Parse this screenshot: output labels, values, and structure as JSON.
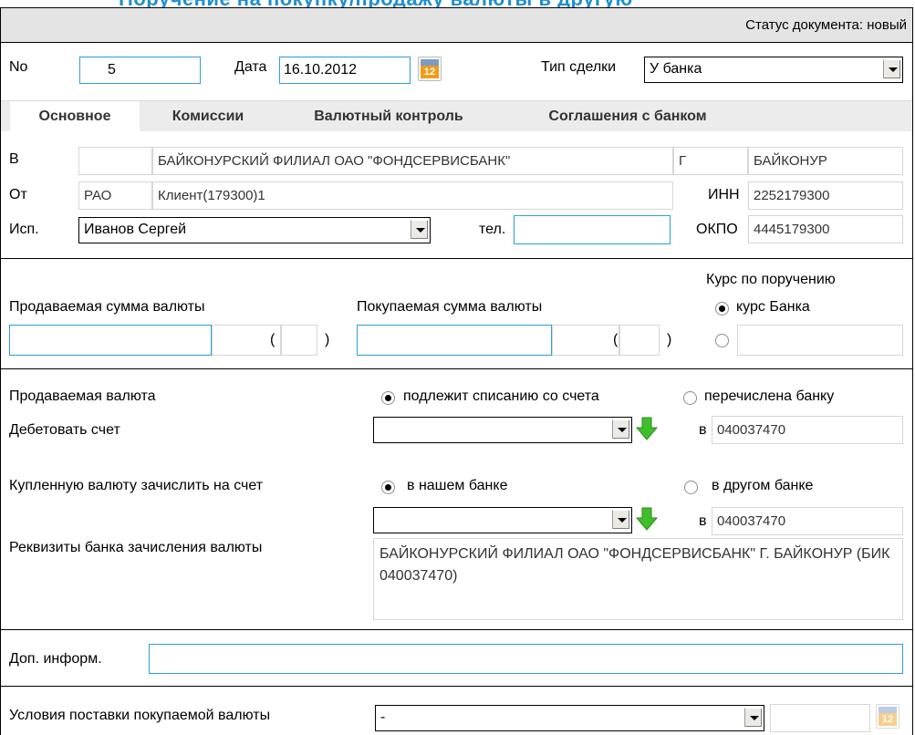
{
  "page_title": "Поручение на покупку/продажу валюты в другую",
  "status": "Статус документа: новый",
  "header": {
    "no_label": "No",
    "no_value": "5",
    "date_label": "Дата",
    "date_value": "16.10.2012",
    "calendar_day": "12",
    "deal_type_label": "Тип сделки",
    "deal_type_value": "У банка"
  },
  "tabs": [
    {
      "label": "Основное",
      "active": true
    },
    {
      "label": "Комиссии",
      "active": false
    },
    {
      "label": "Валютный контроль",
      "active": false
    },
    {
      "label": "Соглашения с банком",
      "active": false
    }
  ],
  "parties": {
    "to_label": "В",
    "to_code": "",
    "to_bank": "БАЙКОНУРСКИЙ ФИЛИАЛ ОАО \"ФОНДСЕРВИСБАНК\"",
    "to_city_prefix": "Г",
    "to_city": "БАЙКОНУР",
    "from_label": "От",
    "from_code": "РАО",
    "from_client": "Клиент(179300)1",
    "inn_label": "ИНН",
    "inn_value": "2252179300",
    "exec_label": "Исп.",
    "exec_value": "Иванов Сергей",
    "phone_label": "тел.",
    "phone_value": "",
    "okpo_label": "ОКПО",
    "okpo_value": "4445179300"
  },
  "amounts": {
    "rate_title": "Курс по поручению",
    "sold_label": "Продаваемая сумма валюты",
    "bought_label": "Покупаемая сумма валюты",
    "rate_bank_label": "курс Банка",
    "paren_open": "(",
    "paren_close": ")"
  },
  "sold_currency": {
    "label": "Продаваемая валюта",
    "opt_debit": "подлежит списанию со счета",
    "opt_transfer": "перечислена банку",
    "debit_label": "Дебетовать счет",
    "in_label": "в",
    "bik": "040037470"
  },
  "bought_currency": {
    "label": "Купленную валюту зачислить на счет",
    "opt_our_bank": "в нашем банке",
    "opt_other_bank": "в другом банке",
    "in_label": "в",
    "bik": "040037470",
    "bank_details_label": "Реквизиты банка зачисления валюты",
    "bank_details": "БАЙКОНУРСКИЙ ФИЛИАЛ ОАО \"ФОНДСЕРВИСБАНК\" Г. БАЙКОНУР (БИК 040037470)"
  },
  "extra": {
    "info_label": "Доп. информ.",
    "info_value": "",
    "delivery_label": "Условия поставки покупаемой валюты",
    "delivery_value": "-",
    "calendar_day": "12"
  },
  "colors": {
    "accent": "#2a9fd8",
    "status_bg": "#e4e4e4",
    "tab_bg": "#ececec",
    "arrow_green": "#3fbf2a"
  }
}
